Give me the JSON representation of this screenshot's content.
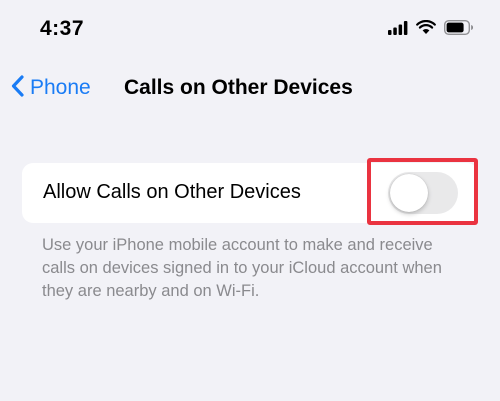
{
  "status_bar": {
    "time": "4:37",
    "icons": [
      "cellular-signal-icon",
      "wifi-icon",
      "battery-icon"
    ]
  },
  "nav": {
    "back_label": "Phone",
    "title": "Calls on Other Devices"
  },
  "settings": {
    "row_label": "Allow Calls on Other Devices",
    "toggle_on": false,
    "footer": "Use your iPhone mobile account to make and receive calls on devices signed in to your iCloud account when they are nearby and on Wi-Fi."
  },
  "colors": {
    "accent": "#1a7cf5",
    "highlight": "#ea3340",
    "background": "#f2f2f7",
    "toggle_off": "#e9e9ea"
  }
}
